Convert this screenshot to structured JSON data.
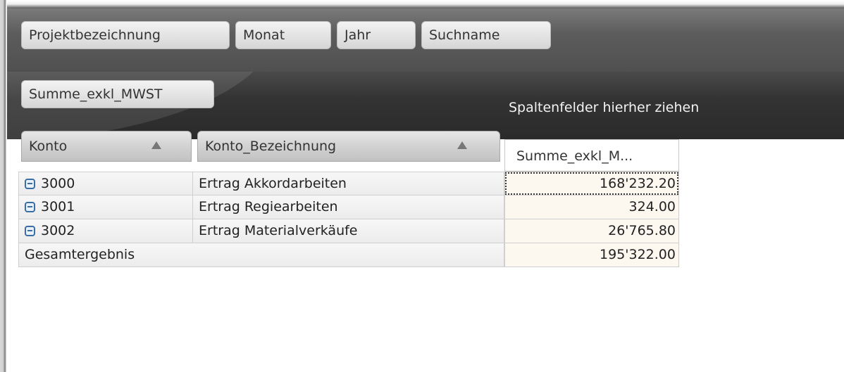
{
  "filter_fields": [
    "Projektbezeichnung",
    "Monat",
    "Jahr",
    "Suchname"
  ],
  "data_field": "Summe_exkl_MWST",
  "column_drop_hint": "Spaltenfelder hierher ziehen",
  "row_headers": [
    {
      "label": "Konto",
      "sort": "ascending"
    },
    {
      "label": "Konto_Bezeichnung",
      "sort": "ascending"
    }
  ],
  "data_header": "Summe_exkl_M...",
  "rows": [
    {
      "konto": "3000",
      "bezeichnung": "Ertrag Akkordarbeiten",
      "value": "168'232.20"
    },
    {
      "konto": "3001",
      "bezeichnung": "Ertrag Regiearbeiten",
      "value": "324.00"
    },
    {
      "konto": "3002",
      "bezeichnung": "Ertrag Materialverkäufe",
      "value": "26'765.80"
    }
  ],
  "total": {
    "label": "Gesamtergebnis",
    "value": "195'322.00"
  },
  "icons": {
    "expand": "collapse-minus-icon",
    "sort": "sort-ascending-icon"
  }
}
